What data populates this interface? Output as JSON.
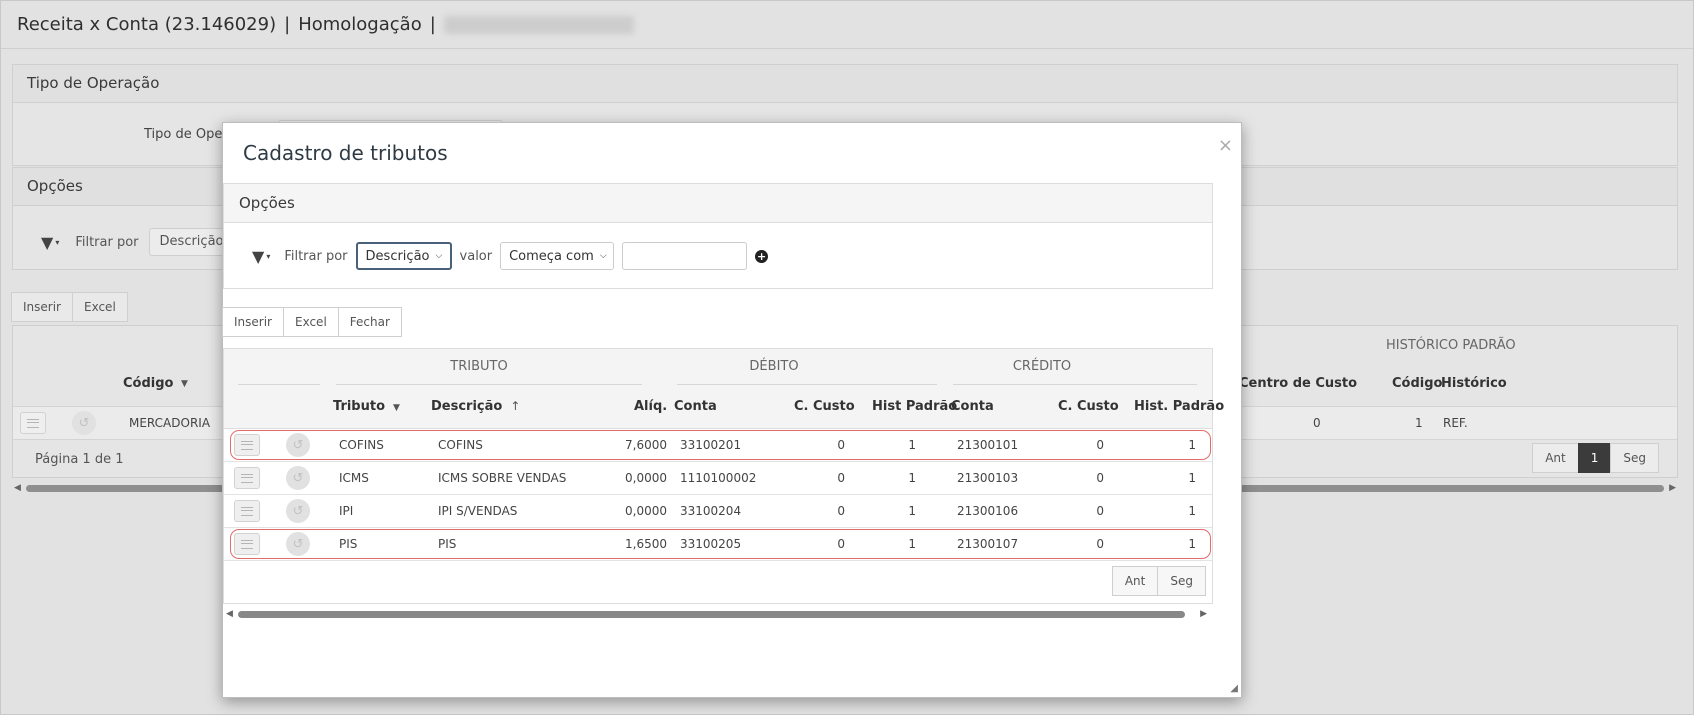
{
  "page": {
    "title_main": "Receita x Conta (23.146029)",
    "sep1": "|",
    "title_env": "Homologação",
    "sep2": "|"
  },
  "bg_panel1": {
    "title": "Tipo de Operação",
    "field_label": "Tipo de Oper"
  },
  "bg_panel2": {
    "title": "Opções",
    "filter_label": "Filtrar por",
    "filter_value": "Descrição d"
  },
  "bg_toolbar": {
    "insert": "Inserir",
    "excel": "Excel"
  },
  "bg_grid": {
    "group_hist": "HISTÓRICO PADRÃO",
    "col_codigo": "Código",
    "col_centro": "Centro de Custo",
    "col_hist_codigo": "Código",
    "col_historico": "Histórico",
    "row": {
      "codigo": "MERCADORIA",
      "centro": "0",
      "hist_codigo": "1",
      "historico": "REF."
    },
    "footer": "Página 1 de 1",
    "pager": {
      "prev": "Ant",
      "current": "1",
      "next": "Seg"
    }
  },
  "modal": {
    "title": "Cadastro de tributos",
    "close": "×",
    "options_title": "Opções",
    "filter": {
      "label": "Filtrar por",
      "field": "Descrição",
      "value_label": "valor",
      "operator": "Começa com",
      "input_value": ""
    },
    "toolbar": {
      "insert": "Inserir",
      "excel": "Excel",
      "close": "Fechar"
    },
    "grid": {
      "groups": {
        "tributo": "TRIBUTO",
        "debito": "DÉBITO",
        "credito": "CRÉDITO"
      },
      "columns": {
        "tributo": "Tributo",
        "descricao": "Descrição",
        "aliq": "Alíq.",
        "deb_conta": "Conta",
        "deb_ccusto": "C. Custo",
        "deb_hist": "Hist Padrão",
        "cred_conta": "Conta",
        "cred_ccusto": "C. Custo",
        "cred_hist": "Hist. Padrão"
      },
      "rows": [
        {
          "tributo": "COFINS",
          "descricao": "COFINS",
          "aliq": "7,6000",
          "deb_conta": "33100201",
          "deb_ccusto": "0",
          "deb_hist": "1",
          "cred_conta": "21300101",
          "cred_ccusto": "0",
          "cred_hist": "1",
          "highlighted": true
        },
        {
          "tributo": "ICMS",
          "descricao": "ICMS SOBRE VENDAS",
          "aliq": "0,0000",
          "deb_conta": "1110100002",
          "deb_ccusto": "0",
          "deb_hist": "1",
          "cred_conta": "21300103",
          "cred_ccusto": "0",
          "cred_hist": "1",
          "highlighted": false
        },
        {
          "tributo": "IPI",
          "descricao": "IPI S/VENDAS",
          "aliq": "0,0000",
          "deb_conta": "33100204",
          "deb_ccusto": "0",
          "deb_hist": "1",
          "cred_conta": "21300106",
          "cred_ccusto": "0",
          "cred_hist": "1",
          "highlighted": false
        },
        {
          "tributo": "PIS",
          "descricao": "PIS",
          "aliq": "1,6500",
          "deb_conta": "33100205",
          "deb_ccusto": "0",
          "deb_hist": "1",
          "cred_conta": "21300107",
          "cred_ccusto": "0",
          "cred_hist": "1",
          "highlighted": true
        }
      ],
      "pager": {
        "prev": "Ant",
        "next": "Seg"
      }
    },
    "highlight_color": "#e26b6b"
  }
}
